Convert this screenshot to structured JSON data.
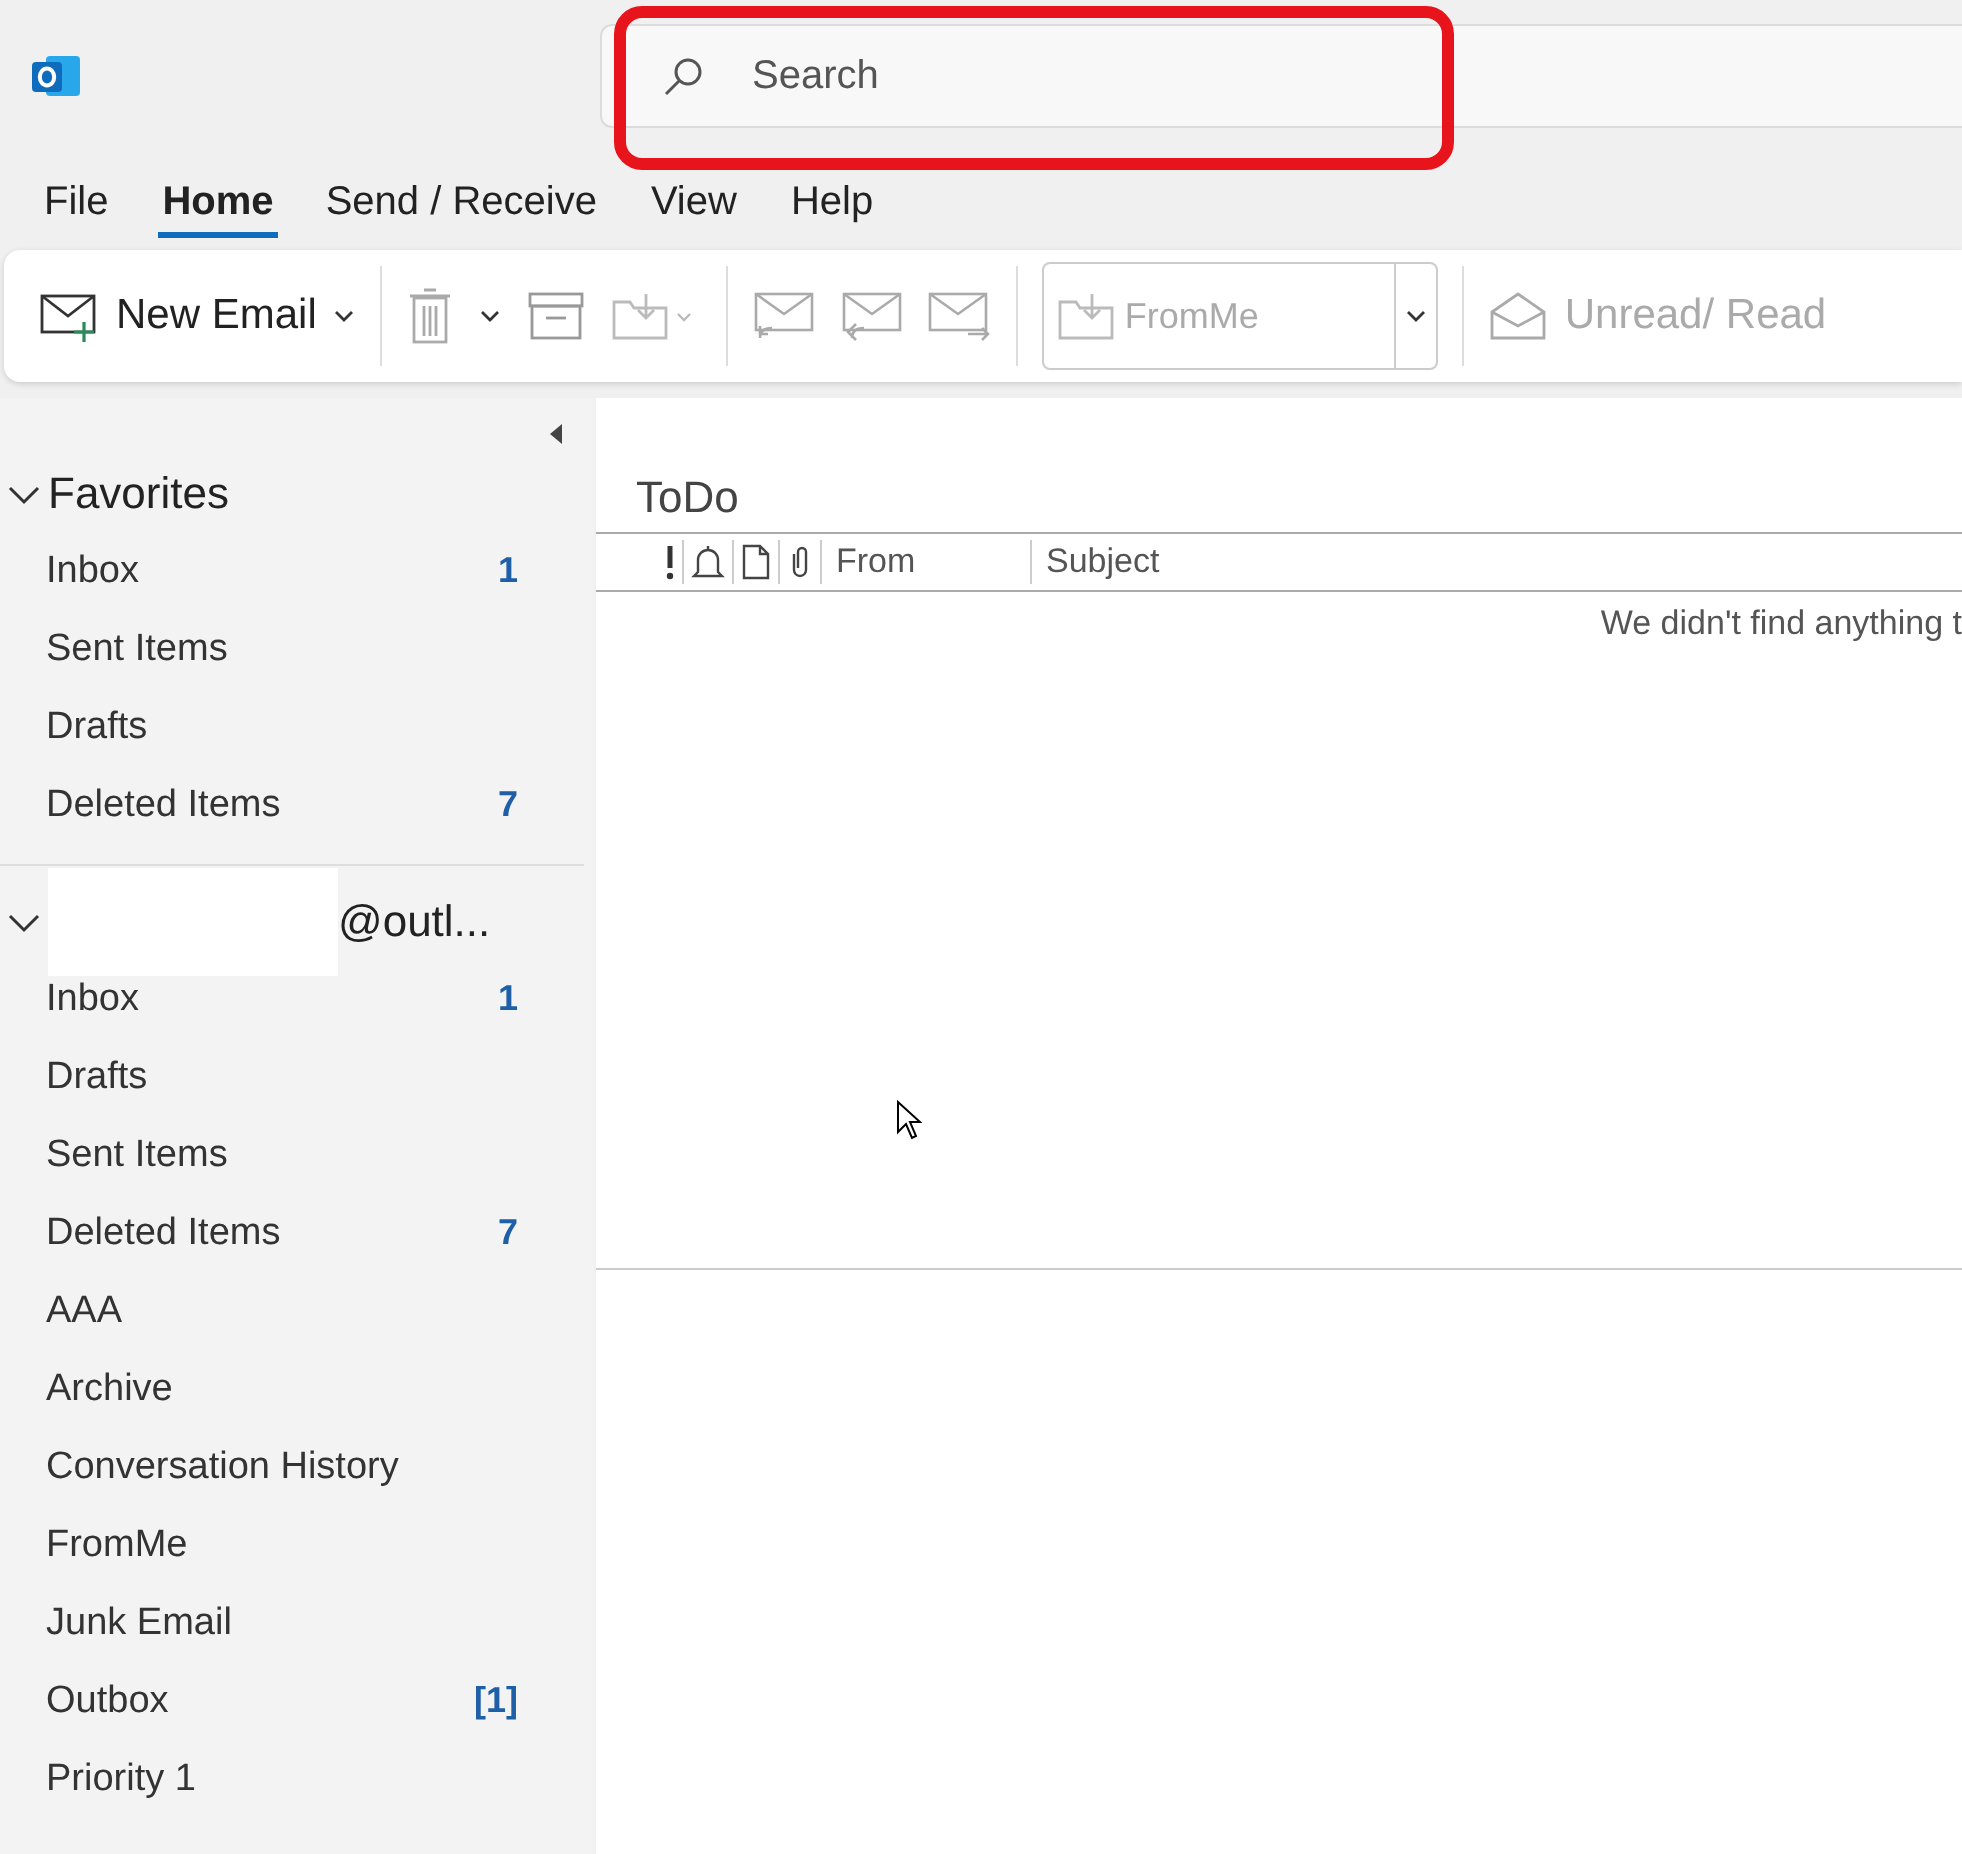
{
  "search": {
    "placeholder": "Search",
    "highlighted": true
  },
  "menu_tabs": [
    {
      "label": "File",
      "selected": false
    },
    {
      "label": "Home",
      "selected": true
    },
    {
      "label": "Send / Receive",
      "selected": false
    },
    {
      "label": "View",
      "selected": false
    },
    {
      "label": "Help",
      "selected": false
    }
  ],
  "ribbon": {
    "new_email": "New Email",
    "move_to_folder": "FromMe",
    "unread_read": "Unread/ Read"
  },
  "sidebar": {
    "groups": [
      {
        "kind": "favorites",
        "title": "Favorites",
        "expanded": true,
        "items": [
          {
            "label": "Inbox",
            "count": "1"
          },
          {
            "label": "Sent Items"
          },
          {
            "label": "Drafts"
          },
          {
            "label": "Deleted Items",
            "count": "7"
          }
        ]
      },
      {
        "kind": "account",
        "title": "@outl...",
        "expanded": true,
        "items": [
          {
            "label": "Inbox",
            "count": "1"
          },
          {
            "label": "Drafts"
          },
          {
            "label": "Sent Items"
          },
          {
            "label": "Deleted Items",
            "count": "7"
          },
          {
            "label": "AAA"
          },
          {
            "label": "Archive"
          },
          {
            "label": "Conversation History"
          },
          {
            "label": "FromMe"
          },
          {
            "label": "Junk Email"
          },
          {
            "label": "Outbox",
            "count": "[1]"
          },
          {
            "label": "Priority 1"
          }
        ]
      }
    ]
  },
  "message_list": {
    "folder_title": "ToDo",
    "columns": [
      "From",
      "Subject"
    ],
    "empty_message": "We didn't find anything t"
  }
}
